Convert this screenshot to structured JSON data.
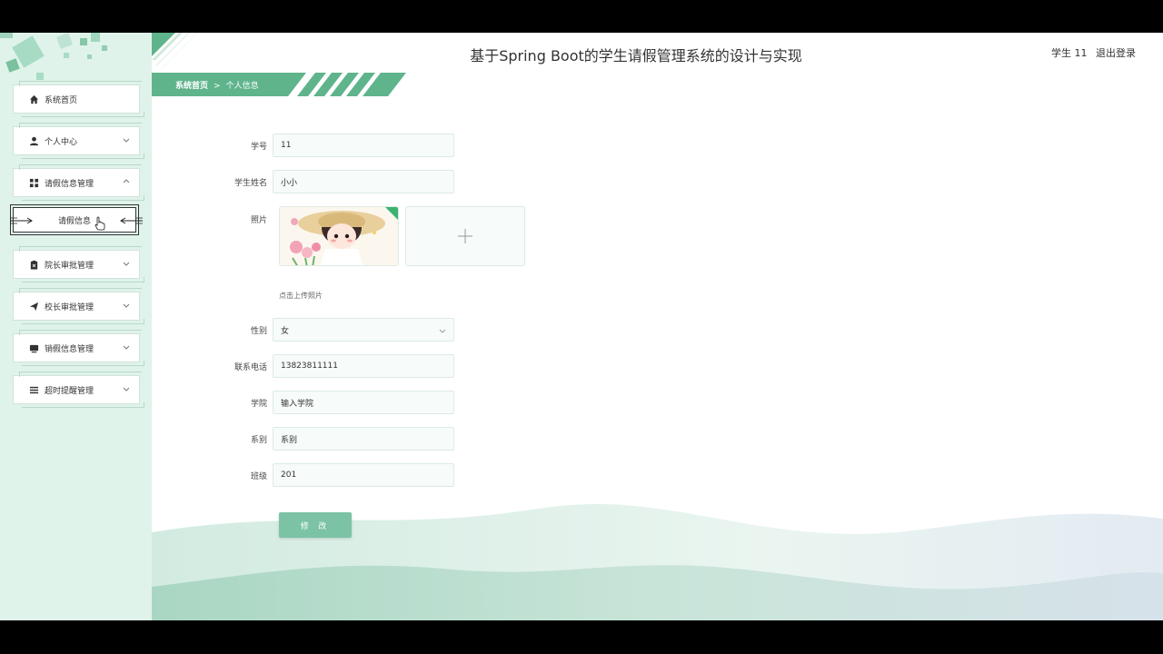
{
  "app": {
    "title": "基于Spring Boot的学生请假管理系统的设计与实现",
    "user_label": "学生 11",
    "logout_label": "退出登录"
  },
  "breadcrumb": {
    "home": "系统首页",
    "separator": ">",
    "current": "个人信息"
  },
  "sidebar": {
    "items": [
      {
        "label": "系统首页",
        "icon": "home-icon"
      },
      {
        "label": "个人中心",
        "icon": "user-icon"
      },
      {
        "label": "请假信息管理",
        "icon": "grid-icon"
      },
      {
        "label": "院长审批管理",
        "icon": "clipboard-icon"
      },
      {
        "label": "校长审批管理",
        "icon": "send-icon"
      },
      {
        "label": "销假信息管理",
        "icon": "monitor-icon"
      },
      {
        "label": "超时提醒管理",
        "icon": "list-icon"
      }
    ],
    "sub_item": {
      "label": "请假信息"
    }
  },
  "form": {
    "student_id": {
      "label": "学号",
      "value": "11"
    },
    "student_name": {
      "label": "学生姓名",
      "value": "小小"
    },
    "photo": {
      "label": "照片",
      "hint": "点击上传照片"
    },
    "gender": {
      "label": "性别",
      "value": "女"
    },
    "phone": {
      "label": "联系电话",
      "value": "13823811111"
    },
    "college": {
      "label": "学院",
      "value": "输入学院"
    },
    "department": {
      "label": "系别",
      "value": "系别"
    },
    "class": {
      "label": "班级",
      "value": "201"
    },
    "submit_label": "修 改"
  },
  "colors": {
    "accent": "#5fb48c",
    "button": "#7cc3a5",
    "sidebar_bg": "#dff3ea"
  }
}
